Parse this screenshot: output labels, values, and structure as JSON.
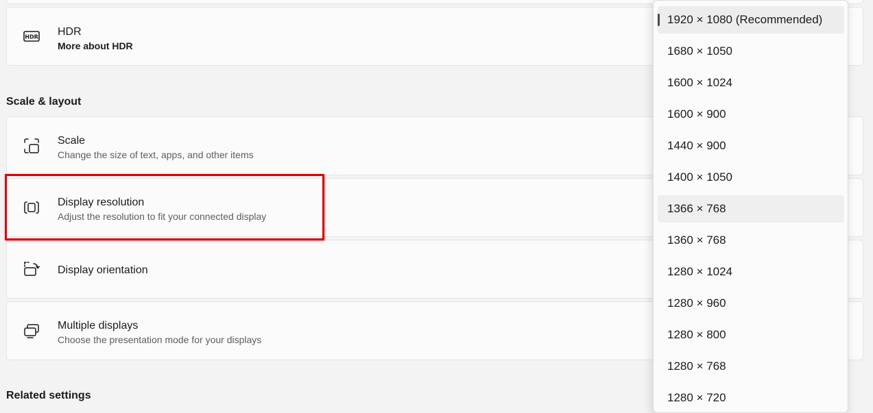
{
  "hdr": {
    "title": "HDR",
    "link": "More about HDR",
    "icon": "hdr-icon"
  },
  "scale_layout": {
    "heading": "Scale & layout",
    "items": [
      {
        "title": "Scale",
        "subtitle": "Change the size of text, apps, and other items",
        "icon": "scale-icon"
      },
      {
        "title": "Display resolution",
        "subtitle": "Adjust the resolution to fit your connected display",
        "icon": "resolution-icon"
      },
      {
        "title": "Display orientation",
        "subtitle": "",
        "icon": "orientation-icon"
      },
      {
        "title": "Multiple displays",
        "subtitle": "Choose the presentation mode for your displays",
        "icon": "multiple-displays-icon"
      }
    ]
  },
  "related": {
    "heading": "Related settings"
  },
  "resolution_dropdown": {
    "selected": "1920 × 1080 (Recommended)",
    "hovered": "1366 × 768",
    "options": [
      "1920 × 1080 (Recommended)",
      "1680 × 1050",
      "1600 × 1024",
      "1600 × 900",
      "1440 × 900",
      "1400 × 1050",
      "1366 × 768",
      "1360 × 768",
      "1280 × 1024",
      "1280 × 960",
      "1280 × 800",
      "1280 × 768",
      "1280 × 720"
    ]
  },
  "colors": {
    "highlight": "#e00000",
    "card_bg": "#fbfbfb",
    "page_bg": "#f3f3f3"
  }
}
